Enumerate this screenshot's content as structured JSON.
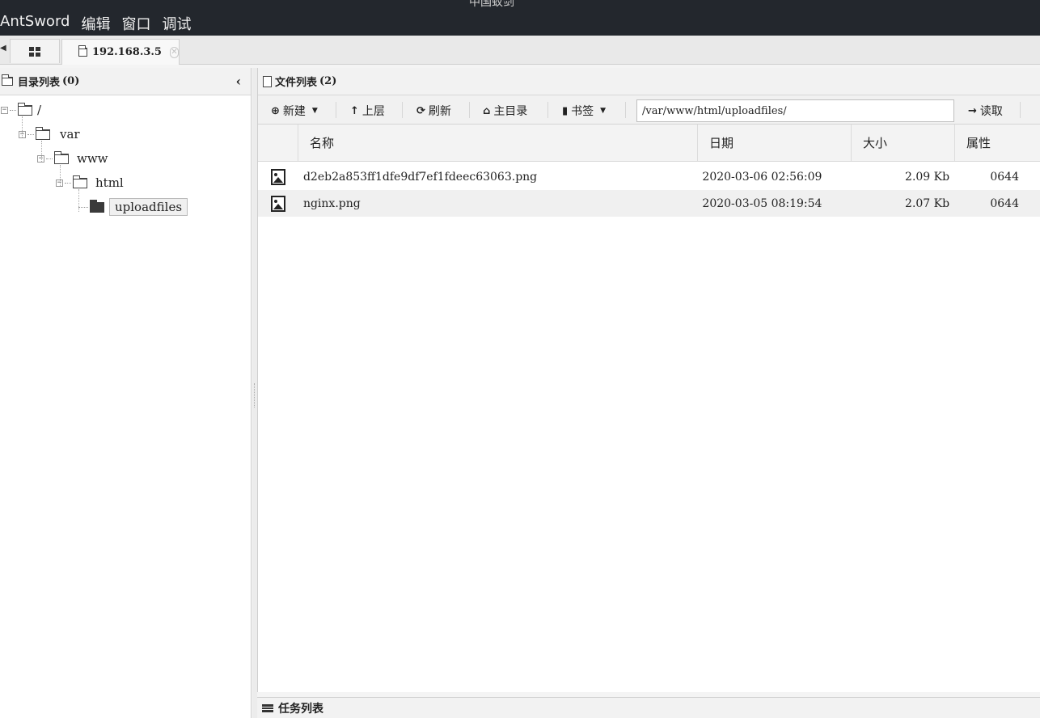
{
  "window": {
    "title": "中国蚁剑"
  },
  "menu": {
    "items": [
      "AntSword",
      "编辑",
      "窗口",
      "调试"
    ]
  },
  "tabs": {
    "host_label": "192.168.3.5",
    "close_symbol": "✕"
  },
  "left_panel": {
    "title": "目录列表",
    "count": "(0)",
    "tree": {
      "root": "/",
      "var": "var",
      "www": "www",
      "html": "html",
      "uploadfiles": "uploadfiles"
    }
  },
  "right_panel": {
    "title": "文件列表",
    "count": "(2)",
    "toolbar": {
      "new": "新建",
      "up": "上层",
      "refresh": "刷新",
      "home": "主目录",
      "bookmark": "书签",
      "path": "/var/www/html/uploadfiles/",
      "read": "读取"
    },
    "columns": [
      "名称",
      "日期",
      "大小",
      "属性"
    ],
    "files": [
      {
        "name": "d2eb2a853ff1dfe9df7ef1fdeec63063.png",
        "date": "2020-03-06 02:56:09",
        "size": "2.09 Kb",
        "attr": "0644"
      },
      {
        "name": "nginx.png",
        "date": "2020-03-05 08:19:54",
        "size": "2.07 Kb",
        "attr": "0644"
      }
    ]
  },
  "task_panel": {
    "title": "任务列表"
  }
}
